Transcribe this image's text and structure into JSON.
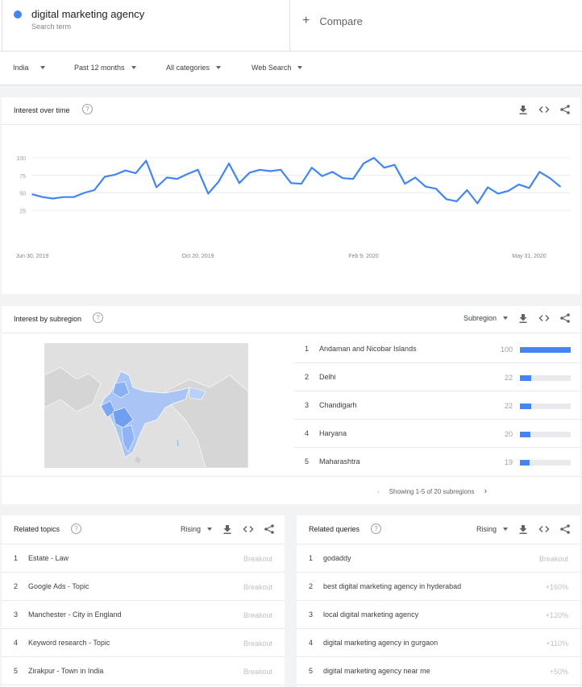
{
  "search": {
    "term": "digital marketing agency",
    "term_sub": "Search term",
    "compare_label": "Compare"
  },
  "filters": [
    {
      "label": "India"
    },
    {
      "label": "Past 12 months"
    },
    {
      "label": "All categories"
    },
    {
      "label": "Web Search"
    }
  ],
  "interest_over_time": {
    "title": "Interest over time",
    "help": "?",
    "chart_data": {
      "type": "line",
      "title": "",
      "xlabel": "",
      "ylabel": "",
      "ylim": [
        0,
        100
      ],
      "yticks": [
        25,
        50,
        75,
        100
      ],
      "xtick_labels": [
        "Jun 30, 2019",
        "Oct 20, 2019",
        "Feb 9, 2020",
        "May 31, 2020"
      ],
      "xtick_indices": [
        0,
        16,
        32,
        48
      ],
      "grid": true,
      "series_color": "#4285f4",
      "values": [
        48,
        44,
        42,
        44,
        44,
        50,
        54,
        73,
        76,
        82,
        78,
        96,
        58,
        72,
        70,
        77,
        83,
        49,
        66,
        92,
        64,
        79,
        83,
        81,
        83,
        64,
        63,
        86,
        74,
        80,
        71,
        70,
        92,
        100,
        86,
        90,
        63,
        72,
        59,
        56,
        41,
        38,
        54,
        35,
        58,
        49,
        53,
        62,
        57,
        80,
        71,
        59
      ]
    }
  },
  "subregion": {
    "title": "Interest by subregion",
    "help": "?",
    "select_label": "Subregion",
    "rows": [
      {
        "rank": "1",
        "name": "Andaman and Nicobar Islands",
        "value": 100
      },
      {
        "rank": "2",
        "name": "Delhi",
        "value": 22
      },
      {
        "rank": "3",
        "name": "Chandigarh",
        "value": 22
      },
      {
        "rank": "4",
        "name": "Haryana",
        "value": 20
      },
      {
        "rank": "5",
        "name": "Maharashtra",
        "value": 19
      }
    ],
    "pager_text": "Showing 1-5 of 20 subregions",
    "bar_color": "#4285f4"
  },
  "related_topics": {
    "title": "Related topics",
    "help": "?",
    "select_label": "Rising",
    "rows": [
      {
        "rank": "1",
        "label": "Estate - Law",
        "value": "Breakout"
      },
      {
        "rank": "2",
        "label": "Google Ads - Topic",
        "value": "Breakout"
      },
      {
        "rank": "3",
        "label": "Manchester - City in England",
        "value": "Breakout"
      },
      {
        "rank": "4",
        "label": "Keyword research - Topic",
        "value": "Breakout"
      },
      {
        "rank": "5",
        "label": "Zirakpur - Town in India",
        "value": "Breakout"
      }
    ]
  },
  "related_queries": {
    "title": "Related queries",
    "help": "?",
    "select_label": "Rising",
    "rows": [
      {
        "rank": "1",
        "label": "godaddy",
        "value": "Breakout"
      },
      {
        "rank": "2",
        "label": "best digital marketing agency in hyderabad",
        "value": "+160%"
      },
      {
        "rank": "3",
        "label": "local digital marketing agency",
        "value": "+120%"
      },
      {
        "rank": "4",
        "label": "digital marketing agency in gurgaon",
        "value": "+110%"
      },
      {
        "rank": "5",
        "label": "digital marketing agency near me",
        "value": "+50%"
      }
    ]
  }
}
